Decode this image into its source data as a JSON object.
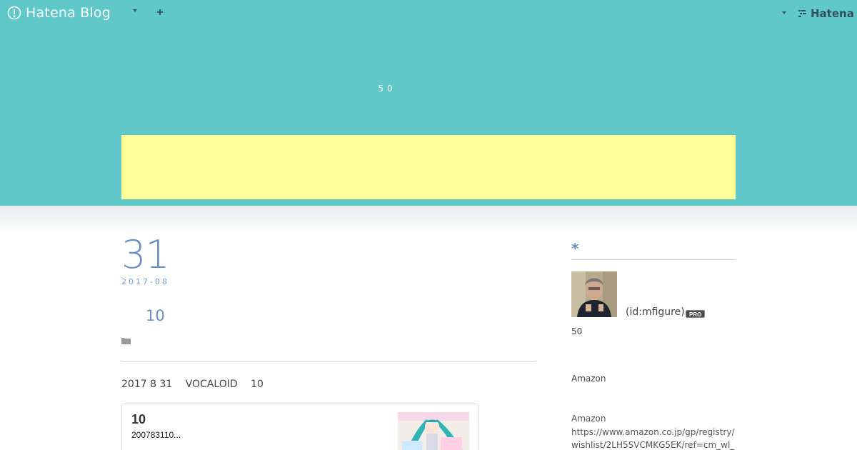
{
  "topbar": {
    "brand": "Hatena Blog",
    "plus_symbol": "+",
    "hatena_label": "Hatena"
  },
  "header": {
    "description": "50",
    "banner_color": "#ffff99",
    "background_color": "#61c8c9"
  },
  "entry": {
    "day": "31",
    "year_month": "2017-08",
    "title": "10",
    "body_parts": [
      "2017 8 31",
      "VOCALOID",
      "10"
    ],
    "card": {
      "title": "10",
      "description": "200783110..."
    }
  },
  "sidebar": {
    "heading_icon": "*",
    "profile_id": "(id:mfigure)",
    "pro_badge": "PRO",
    "profile_text": "50",
    "amazon_label": "Amazon",
    "amazon_heading": "Amazon",
    "amazon_link": "https://www.amazon.co.jp/gp/registry/wishlist/2LH5SVCMKG5EK/ref=cm_wl_"
  },
  "colors": {
    "accent": "#6a8fc2",
    "header": "#61c8c9"
  }
}
